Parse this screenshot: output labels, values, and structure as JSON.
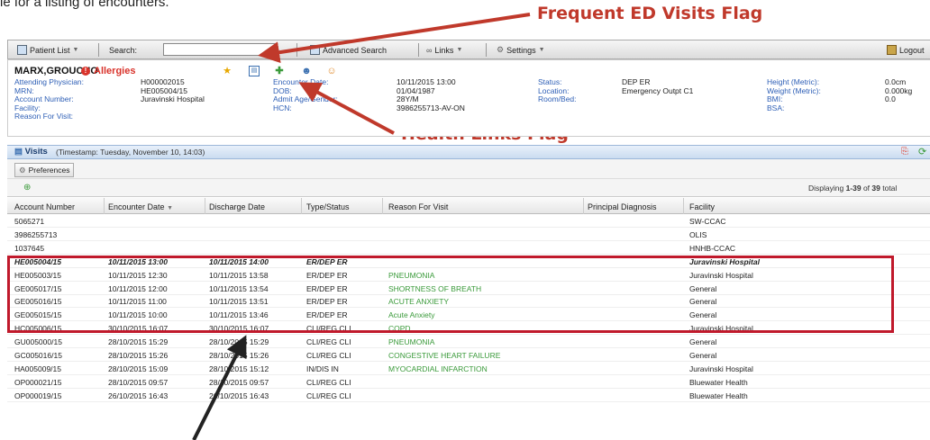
{
  "caption": "le for a listing of encounters.",
  "flags": {
    "frequent_ed": "Frequent ED Visits Flag",
    "health_links": "Health Links Flag"
  },
  "toolbar": {
    "patient_list": "Patient List",
    "search_label": "Search:",
    "search_value": "",
    "advanced_search": "Advanced Search",
    "links": "Links",
    "settings": "Settings",
    "logout": "Logout"
  },
  "patient": {
    "name": "MARX,GROUCHO",
    "allergies": "Allergies",
    "col1": [
      {
        "label": "Attending Physician:",
        "value": ""
      },
      {
        "label": "MRN:",
        "value": "H000002015"
      },
      {
        "label": "Account Number:",
        "value": "HE005004/15"
      },
      {
        "label": "Facility:",
        "value": "Juravinski Hospital"
      },
      {
        "label": "Reason For Visit:",
        "value": ""
      }
    ],
    "col2": [
      {
        "label": "Encounter Date:",
        "value": "10/11/2015 13:00"
      },
      {
        "label": "DOB:",
        "value": "01/04/1987"
      },
      {
        "label": "Admit Age/Gender:",
        "value": "28Y/M"
      },
      {
        "label": "HCN:",
        "value": "3986255713-AV-ON"
      }
    ],
    "col3": [
      {
        "label": "Status:",
        "value": "DEP ER"
      },
      {
        "label": "Location:",
        "value": "Emergency Outpt C1"
      },
      {
        "label": "Room/Bed:",
        "value": ""
      }
    ],
    "col4": [
      {
        "label": "Height (Metric):",
        "value": "0.0cm"
      },
      {
        "label": "Weight (Metric):",
        "value": "0.000kg"
      },
      {
        "label": "BMI:",
        "value": "0.0"
      },
      {
        "label": "BSA:",
        "value": ""
      }
    ]
  },
  "visits": {
    "title": "Visits",
    "timestamp": "(Timestamp: Tuesday, November 10, 14:03)",
    "preferences": "Preferences",
    "display_prefix": "Displaying ",
    "display_range": "1-39",
    "display_of": " of ",
    "display_total": "39",
    "display_suffix": " total"
  },
  "table": {
    "headers": [
      "Account Number",
      "Encounter Date",
      "Discharge Date",
      "Type/Status",
      "Reason For Visit",
      "Principal Diagnosis",
      "Facility"
    ],
    "rows": [
      [
        "5065271",
        "",
        "",
        "",
        "",
        "",
        "SW-CCAC"
      ],
      [
        "3986255713",
        "",
        "",
        "",
        "",
        "",
        "OLIS"
      ],
      [
        "1037645",
        "",
        "",
        "",
        "",
        "",
        "HNHB-CCAC"
      ],
      [
        "HE005004/15",
        "10/11/2015 13:00",
        "10/11/2015 14:00",
        "ER/DEP ER",
        "",
        "",
        "Juravinski Hospital"
      ],
      [
        "HE005003/15",
        "10/11/2015 12:30",
        "10/11/2015 13:58",
        "ER/DEP ER",
        "PNEUMONIA",
        "",
        "Juravinski Hospital"
      ],
      [
        "GE005017/15",
        "10/11/2015 12:00",
        "10/11/2015 13:54",
        "ER/DEP ER",
        "SHORTNESS OF BREATH",
        "",
        "General"
      ],
      [
        "GE005016/15",
        "10/11/2015 11:00",
        "10/11/2015 13:51",
        "ER/DEP ER",
        "ACUTE ANXIETY",
        "",
        "General"
      ],
      [
        "GE005015/15",
        "10/11/2015 10:00",
        "10/11/2015 13:46",
        "ER/DEP ER",
        "Acute Anxiety",
        "",
        "General"
      ],
      [
        "HC005006/15",
        "30/10/2015 16:07",
        "30/10/2015 16:07",
        "CLI/REG CLI",
        "COPD",
        "",
        "Juravinski Hospital"
      ],
      [
        "GU005000/15",
        "28/10/2015 15:29",
        "28/10/2015 15:29",
        "CLI/REG CLI",
        "PNEUMONIA",
        "",
        "General"
      ],
      [
        "GC005016/15",
        "28/10/2015 15:26",
        "28/10/2015 15:26",
        "CLI/REG CLI",
        "CONGESTIVE HEART FAILURE",
        "",
        "General"
      ],
      [
        "HA005009/15",
        "28/10/2015 15:09",
        "28/10/2015 15:12",
        "IN/DIS IN",
        "MYOCARDIAL INFARCTION",
        "",
        "Juravinski Hospital"
      ],
      [
        "OP000021/15",
        "28/10/2015 09:57",
        "28/10/2015 09:57",
        "CLI/REG CLI",
        "",
        "",
        "Bluewater Health"
      ],
      [
        "OP000019/15",
        "26/10/2015 16:43",
        "26/10/2015 16:43",
        "CLI/REG CLI",
        "",
        "",
        "Bluewater Health"
      ]
    ]
  }
}
